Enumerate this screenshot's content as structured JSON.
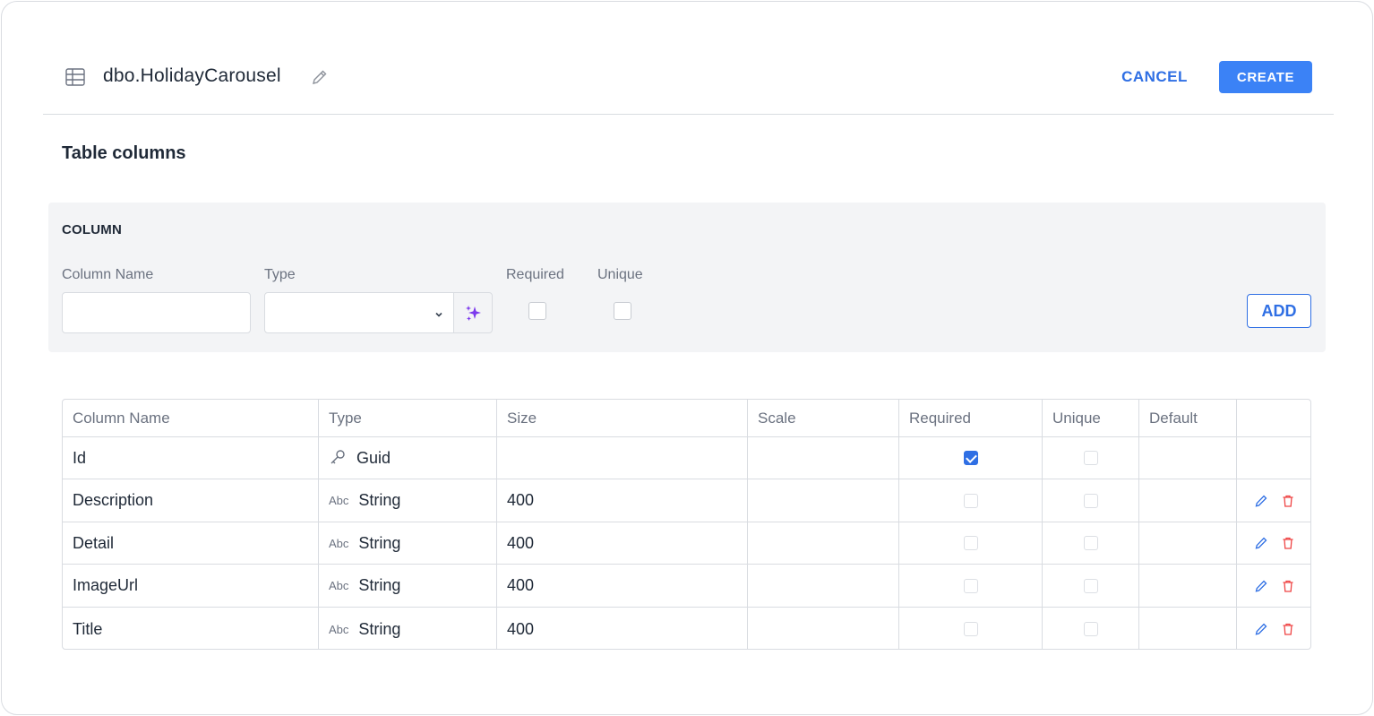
{
  "header": {
    "title": "dbo.HolidayCarousel",
    "cancel_label": "CANCEL",
    "create_label": "CREATE"
  },
  "section_title": "Table columns",
  "form": {
    "heading": "COLUMN",
    "column_name_label": "Column Name",
    "column_name_value": "",
    "type_label": "Type",
    "type_value": "",
    "required_label": "Required",
    "unique_label": "Unique",
    "add_label": "ADD"
  },
  "table": {
    "headers": [
      "Column Name",
      "Type",
      "Size",
      "Scale",
      "Required",
      "Unique",
      "Default",
      ""
    ],
    "rows": [
      {
        "name": "Id",
        "type_icon": "key-icon",
        "type": "Guid",
        "size": "",
        "scale": "",
        "required": true,
        "unique": false,
        "default": "",
        "actions": false
      },
      {
        "name": "Description",
        "type_icon": "Abc",
        "type": "String",
        "size": "400",
        "scale": "",
        "required": false,
        "unique": false,
        "default": "",
        "actions": true
      },
      {
        "name": "Detail",
        "type_icon": "Abc",
        "type": "String",
        "size": "400",
        "scale": "",
        "required": false,
        "unique": false,
        "default": "",
        "actions": true
      },
      {
        "name": "ImageUrl",
        "type_icon": "Abc",
        "type": "String",
        "size": "400",
        "scale": "",
        "required": false,
        "unique": false,
        "default": "",
        "actions": true
      },
      {
        "name": "Title",
        "type_icon": "Abc",
        "type": "String",
        "size": "400",
        "scale": "",
        "required": false,
        "unique": false,
        "default": "",
        "actions": true
      }
    ]
  },
  "colors": {
    "accent": "#3b82f6",
    "link": "#2f6fe4",
    "delete": "#ef4444",
    "magic": "#7c3aed"
  }
}
